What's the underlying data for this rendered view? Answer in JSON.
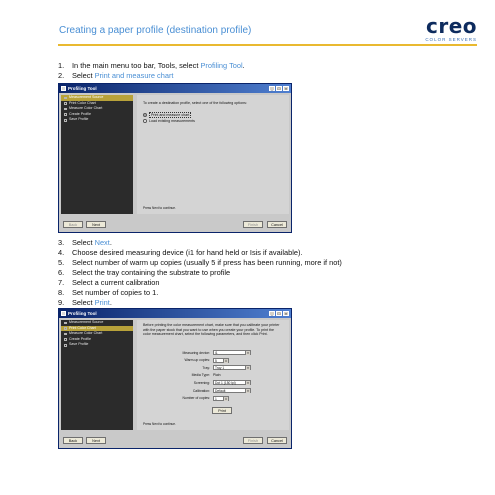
{
  "header": {
    "title": "Creating a paper profile (destination profile)",
    "logo_word": "creo",
    "logo_sub": "COLOR SERVERS"
  },
  "steps_a": [
    {
      "num": "1.",
      "text": "In the main menu too bar, Tools, select ",
      "link": "Profiling Tool",
      "tail": "."
    },
    {
      "num": "2.",
      "text": "Select ",
      "link": "Print and measure chart",
      "tail": ""
    }
  ],
  "steps_b": [
    {
      "num": "3.",
      "text": "Select ",
      "link": "Next",
      "tail": "."
    },
    {
      "num": "4.",
      "text": "Choose desired measuring device (i1 for hand held or Isis if available).",
      "link": "",
      "tail": ""
    },
    {
      "num": "5.",
      "text": "Select number of warm up copies (usually 5 if press has been running, more if not)",
      "link": "",
      "tail": ""
    },
    {
      "num": "6.",
      "text": "Select the tray containing the substrate to profile",
      "link": "",
      "tail": ""
    },
    {
      "num": "7.",
      "text": "Select a current calibration",
      "link": "",
      "tail": ""
    },
    {
      "num": "8.",
      "text": "Set number of copies to 1.",
      "link": "",
      "tail": ""
    },
    {
      "num": "9.",
      "text": "Select ",
      "link": "Print",
      "tail": "."
    }
  ],
  "window1": {
    "title": "Profiling Tool",
    "sidebar": [
      "Measurement Source",
      "Print Color Chart",
      "Measure Color Chart",
      "Create Profile",
      "Save Profile"
    ],
    "active_index": 0,
    "intro": "To create a destination profile, select one of the following options:",
    "options": [
      {
        "label": "Print and measure chart",
        "selected": true
      },
      {
        "label": "Load existing measurements",
        "selected": false
      }
    ],
    "press_next": "Press Next to continue.",
    "buttons": {
      "back": "Back",
      "next": "Next",
      "finish": "Finish",
      "cancel": "Cancel"
    }
  },
  "window2": {
    "title": "Profiling Tool",
    "sidebar": [
      "Measurement Source",
      "Print Color Chart",
      "Measure Color Chart",
      "Create Profile",
      "Save Profile"
    ],
    "active_index": 1,
    "intro": "Before printing the color measurement chart, make sure that you calibrate your printer with the paper stock that you want to use when you create your profile. To print the color measurement chart, select the following parameters, and then click Print.",
    "fields": [
      {
        "label": "Measuring device:",
        "value": "i1",
        "kind": "select"
      },
      {
        "label": "Warm-up copies:",
        "value": "5",
        "kind": "spin"
      },
      {
        "label": "Tray:",
        "value": "Tray 1",
        "kind": "select"
      },
      {
        "label": "Media Type:",
        "value": "Plain",
        "kind": "plain"
      },
      {
        "label": "Screening:",
        "value": "Dot 1 (150 lpi)",
        "kind": "select"
      },
      {
        "label": "Calibration:",
        "value": "Default",
        "kind": "select"
      },
      {
        "label": "Number of copies:",
        "value": "1",
        "kind": "spin"
      }
    ],
    "print_label": "Print",
    "press_next": "Press Next to continue.",
    "buttons": {
      "back": "Back",
      "next": "Next",
      "finish": "Finish",
      "cancel": "Cancel"
    }
  }
}
